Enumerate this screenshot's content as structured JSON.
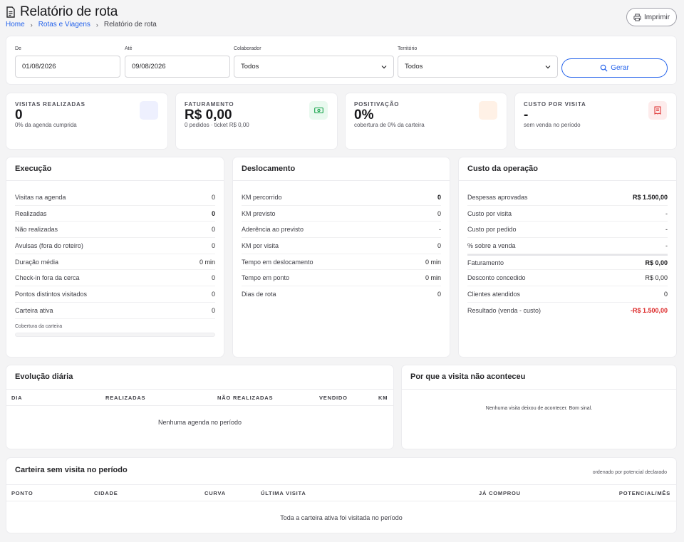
{
  "header": {
    "title": "Relatório de rota",
    "print_label": "Imprimir",
    "breadcrumb": {
      "home": "Home",
      "section": "Rotas e Viagens",
      "current": "Relatório de rota"
    }
  },
  "filters": {
    "from_label": "De",
    "from_value": "01/08/2026",
    "to_label": "Até",
    "to_value": "09/08/2026",
    "collaborator_label": "Colaborador",
    "collaborator_value": "Todos",
    "territory_label": "Território",
    "territory_value": "Todos",
    "generate_label": "Gerar"
  },
  "kpis": [
    {
      "label": "Visitas realizadas",
      "value": "0",
      "sub": "0% da agenda cumprida",
      "icon": "calendar-icon",
      "icon_bg": "#eef0fe"
    },
    {
      "label": "Faturamento",
      "value": "R$ 0,00",
      "sub": "0 pedidos · ticket R$ 0,00",
      "icon": "cash-icon",
      "icon_bg": "#e9f9ef"
    },
    {
      "label": "Positivação",
      "value": "0%",
      "sub": "cobertura de 0% da carteira",
      "icon": "target-icon",
      "icon_bg": "#fff1e6"
    },
    {
      "label": "Custo por visita",
      "value": "-",
      "sub": "sem venda no período",
      "icon": "receipt-icon",
      "icon_bg": "#fdecec"
    }
  ],
  "execucao": {
    "title": "Execução",
    "rows": [
      {
        "label": "Visitas na agenda",
        "value": "0"
      },
      {
        "label": "Realizadas",
        "value": "0"
      },
      {
        "label": "Não realizadas",
        "value": "0"
      },
      {
        "label": "Avulsas (fora do roteiro)",
        "value": "0"
      },
      {
        "label": "Duração média",
        "value": "0 min"
      },
      {
        "label": "Check-in fora da cerca",
        "value": "0"
      },
      {
        "label": "Pontos distintos visitados",
        "value": "0"
      },
      {
        "label": "Carteira ativa",
        "value": "0"
      }
    ],
    "coverage_label": "Cobertura da carteira",
    "coverage_fraction": 0
  },
  "deslocamento": {
    "title": "Deslocamento",
    "rows": [
      {
        "label": "KM percorrido",
        "value": "0"
      },
      {
        "label": "KM previsto",
        "value": "0"
      },
      {
        "label": "Aderência ao previsto",
        "value": "-"
      },
      {
        "label": "KM por visita",
        "value": "0"
      },
      {
        "label": "Tempo em deslocamento",
        "value": "0 min"
      },
      {
        "label": "Tempo em ponto",
        "value": "0 min"
      },
      {
        "label": "Dias de rota",
        "value": "0"
      }
    ]
  },
  "custo": {
    "title": "Custo da operação",
    "rows": [
      {
        "label": "Despesas aprovadas",
        "value": "R$ 1.500,00"
      },
      {
        "label": "Custo por visita",
        "value": "-"
      },
      {
        "label": "Custo por pedido",
        "value": "-"
      },
      {
        "label": "% sobre a venda",
        "value": "-"
      },
      {
        "label": "Faturamento",
        "value": "R$ 0,00"
      },
      {
        "label": "Desconto concedido",
        "value": "R$ 0,00"
      },
      {
        "label": "Clientes atendidos",
        "value": "0"
      },
      {
        "label": "Resultado (venda - custo)",
        "value": "-R$ 1.500,00"
      }
    ],
    "negative_color": "#dc2626"
  },
  "evolucao": {
    "title": "Evolução diária",
    "columns": [
      "Dia",
      "Realizadas",
      "Não realizadas",
      "Vendido",
      "KM"
    ],
    "empty": "Nenhuma agenda no período"
  },
  "motivos": {
    "title": "Por que a visita não aconteceu",
    "empty": "Nenhuma visita deixou de acontecer. Bom sinal."
  },
  "carteira": {
    "title": "Carteira sem visita no período",
    "note": "ordenado por potencial declarado",
    "columns": [
      "Ponto",
      "Cidade",
      "Curva",
      "Última visita",
      "Já comprou",
      "Potencial/mês"
    ],
    "empty": "Toda a carteira ativa foi visitada no período"
  },
  "colors": {
    "accent": "#2563eb",
    "negative": "#dc2626"
  }
}
